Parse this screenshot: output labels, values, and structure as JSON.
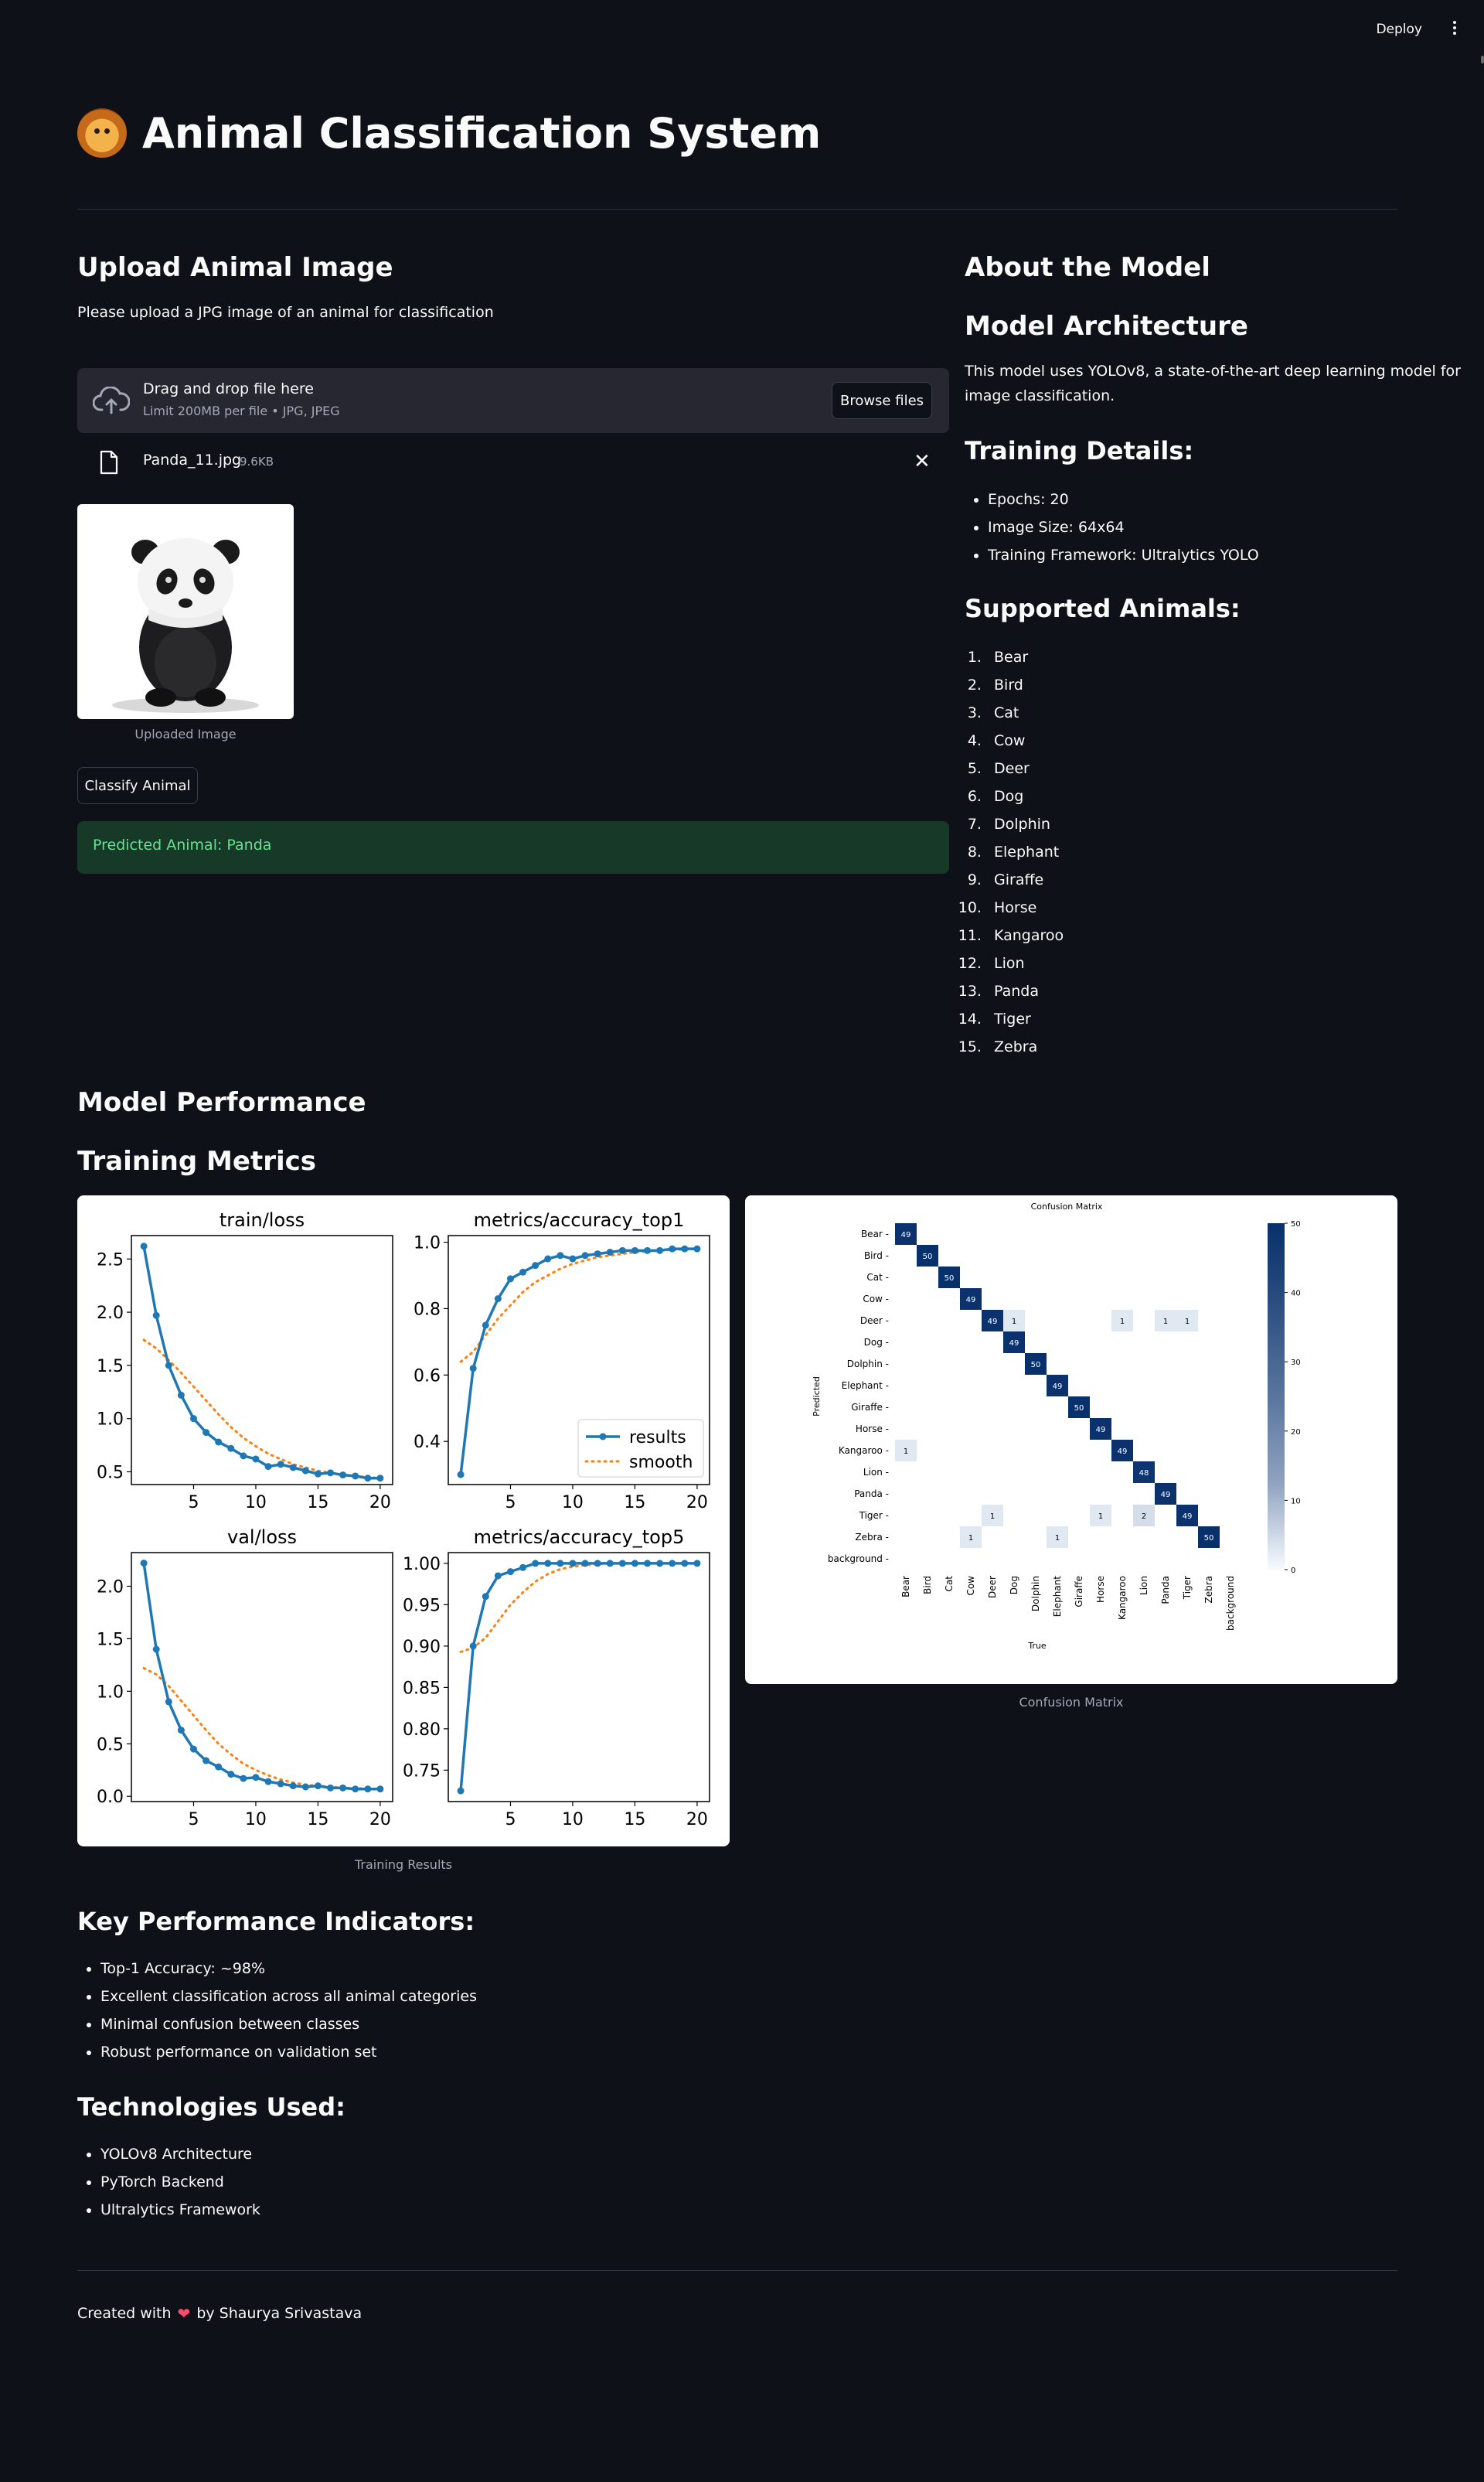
{
  "header": {
    "deploy_label": "Deploy"
  },
  "page": {
    "title": "Animal Classification System"
  },
  "upload": {
    "heading": "Upload Animal Image",
    "instruction": "Please upload a JPG image of an animal for classification",
    "drag_text": "Drag and drop file here",
    "limit_text": "Limit 200MB per file • JPG, JPEG",
    "browse_label": "Browse files",
    "file_name": "Panda_11.jpg",
    "file_size": "9.6KB",
    "image_caption": "Uploaded Image",
    "classify_label": "Classify Animal",
    "result_text": "Predicted Animal: Panda"
  },
  "about": {
    "heading": "About the Model",
    "arch_heading": "Model Architecture",
    "arch_text_1": "This model uses YOLOv8, a state-of-the-art deep learning model for",
    "arch_text_2": "image classification.",
    "training_heading": "Training Details:",
    "training_items": [
      "Epochs: 20",
      "Image Size: 64x64",
      "Training Framework: Ultralytics YOLO"
    ],
    "animals_heading": "Supported Animals:",
    "animals": [
      "Bear",
      "Bird",
      "Cat",
      "Cow",
      "Deer",
      "Dog",
      "Dolphin",
      "Elephant",
      "Giraffe",
      "Horse",
      "Kangaroo",
      "Lion",
      "Panda",
      "Tiger",
      "Zebra"
    ]
  },
  "performance": {
    "heading": "Model Performance",
    "metrics_heading": "Training Metrics",
    "training_caption": "Training Results",
    "cm_caption": "Confusion Matrix",
    "kpi_heading": "Key Performance Indicators:",
    "kpi_items": [
      "Top-1 Accuracy: ~98%",
      "Excellent classification across all animal categories",
      "Minimal confusion between classes",
      "Robust performance on validation set"
    ],
    "tech_heading": "Technologies Used:",
    "tech_items": [
      "YOLOv8 Architecture",
      "PyTorch Backend",
      "Ultralytics Framework"
    ]
  },
  "footer": {
    "prefix": "Created with",
    "suffix": "by Shaurya Srivastava"
  },
  "colors": {
    "background": "#0e1117",
    "result_bg": "#173928",
    "result_text": "#66e28f",
    "series_results": "#1f77b4",
    "series_smooth": "#ff7f0e",
    "cm_high": "#08306b"
  },
  "chart_data": [
    {
      "type": "line",
      "title": "train/loss",
      "x": [
        1,
        2,
        3,
        4,
        5,
        6,
        7,
        8,
        9,
        10,
        11,
        12,
        13,
        14,
        15,
        16,
        17,
        18,
        19,
        20
      ],
      "series": [
        {
          "name": "results",
          "values": [
            2.62,
            1.97,
            1.5,
            1.22,
            1.0,
            0.87,
            0.78,
            0.72,
            0.65,
            0.62,
            0.55,
            0.57,
            0.54,
            0.51,
            0.48,
            0.49,
            0.47,
            0.46,
            0.44,
            0.44
          ]
        },
        {
          "name": "smooth",
          "values": [
            1.74,
            1.66,
            1.55,
            1.43,
            1.3,
            1.17,
            1.04,
            0.92,
            0.82,
            0.74,
            0.67,
            0.62,
            0.57,
            0.54,
            0.51,
            0.49,
            0.47,
            0.46,
            0.45,
            0.44
          ]
        }
      ],
      "xticks": [
        5,
        10,
        15,
        20
      ],
      "yticks": [
        0.5,
        1.0,
        1.5,
        2.0,
        2.5
      ],
      "xlim": [
        0,
        21
      ],
      "ylim": [
        0.38,
        2.72
      ]
    },
    {
      "type": "line",
      "title": "metrics/accuracy_top1",
      "x": [
        1,
        2,
        3,
        4,
        5,
        6,
        7,
        8,
        9,
        10,
        11,
        12,
        13,
        14,
        15,
        16,
        17,
        18,
        19,
        20
      ],
      "series": [
        {
          "name": "results",
          "values": [
            0.3,
            0.62,
            0.75,
            0.83,
            0.89,
            0.91,
            0.93,
            0.95,
            0.96,
            0.95,
            0.96,
            0.965,
            0.97,
            0.975,
            0.975,
            0.975,
            0.975,
            0.98,
            0.98,
            0.98
          ]
        },
        {
          "name": "smooth",
          "values": [
            0.64,
            0.67,
            0.72,
            0.77,
            0.81,
            0.85,
            0.88,
            0.9,
            0.92,
            0.935,
            0.945,
            0.955,
            0.96,
            0.965,
            0.97,
            0.972,
            0.975,
            0.977,
            0.978,
            0.98
          ]
        }
      ],
      "xticks": [
        5,
        10,
        15,
        20
      ],
      "yticks": [
        0.4,
        0.6,
        0.8,
        1.0
      ],
      "xlim": [
        0,
        21
      ],
      "ylim": [
        0.27,
        1.02
      ],
      "legend": "lower-right"
    },
    {
      "type": "line",
      "title": "val/loss",
      "x": [
        1,
        2,
        3,
        4,
        5,
        6,
        7,
        8,
        9,
        10,
        11,
        12,
        13,
        14,
        15,
        16,
        17,
        18,
        19,
        20
      ],
      "series": [
        {
          "name": "results",
          "values": [
            2.22,
            1.4,
            0.9,
            0.63,
            0.45,
            0.34,
            0.28,
            0.21,
            0.17,
            0.18,
            0.14,
            0.12,
            0.1,
            0.09,
            0.1,
            0.08,
            0.08,
            0.07,
            0.07,
            0.07
          ]
        },
        {
          "name": "smooth",
          "values": [
            1.22,
            1.16,
            1.05,
            0.91,
            0.77,
            0.63,
            0.5,
            0.4,
            0.31,
            0.25,
            0.2,
            0.16,
            0.13,
            0.11,
            0.1,
            0.09,
            0.08,
            0.08,
            0.07,
            0.07
          ]
        }
      ],
      "xticks": [
        5,
        10,
        15,
        20
      ],
      "yticks": [
        0.0,
        0.5,
        1.0,
        1.5,
        2.0
      ],
      "xlim": [
        0,
        21
      ],
      "ylim": [
        -0.05,
        2.32
      ]
    },
    {
      "type": "line",
      "title": "metrics/accuracy_top5",
      "x": [
        1,
        2,
        3,
        4,
        5,
        6,
        7,
        8,
        9,
        10,
        11,
        12,
        13,
        14,
        15,
        16,
        17,
        18,
        19,
        20
      ],
      "series": [
        {
          "name": "results",
          "values": [
            0.725,
            0.9,
            0.96,
            0.985,
            0.99,
            0.995,
            1.0,
            1.0,
            1.0,
            1.0,
            1.0,
            1.0,
            1.0,
            1.0,
            1.0,
            1.0,
            1.0,
            1.0,
            1.0,
            1.0
          ]
        },
        {
          "name": "smooth",
          "values": [
            0.893,
            0.898,
            0.91,
            0.93,
            0.95,
            0.965,
            0.978,
            0.987,
            0.993,
            0.996,
            0.998,
            0.999,
            1.0,
            1.0,
            1.0,
            1.0,
            1.0,
            1.0,
            1.0,
            1.0
          ]
        }
      ],
      "xticks": [
        5,
        10,
        15,
        20
      ],
      "yticks": [
        0.75,
        0.8,
        0.85,
        0.9,
        0.95,
        1.0
      ],
      "xlim": [
        0,
        21
      ],
      "ylim": [
        0.712,
        1.013
      ]
    },
    {
      "type": "heatmap",
      "title": "Confusion Matrix",
      "xlabel": "True",
      "ylabel": "Predicted",
      "labels": [
        "Bear",
        "Bird",
        "Cat",
        "Cow",
        "Deer",
        "Dog",
        "Dolphin",
        "Elephant",
        "Giraffe",
        "Horse",
        "Kangaroo",
        "Lion",
        "Panda",
        "Tiger",
        "Zebra",
        "background"
      ],
      "cells": [
        [
          0,
          0,
          49
        ],
        [
          1,
          1,
          50
        ],
        [
          2,
          2,
          50
        ],
        [
          3,
          3,
          49
        ],
        [
          4,
          4,
          49
        ],
        [
          4,
          5,
          1
        ],
        [
          4,
          10,
          1
        ],
        [
          4,
          12,
          1
        ],
        [
          4,
          13,
          1
        ],
        [
          5,
          5,
          49
        ],
        [
          6,
          6,
          50
        ],
        [
          7,
          7,
          49
        ],
        [
          8,
          8,
          50
        ],
        [
          9,
          9,
          49
        ],
        [
          10,
          10,
          49
        ],
        [
          10,
          0,
          1
        ],
        [
          11,
          11,
          48
        ],
        [
          12,
          12,
          49
        ],
        [
          13,
          13,
          49
        ],
        [
          13,
          4,
          1
        ],
        [
          13,
          9,
          1
        ],
        [
          13,
          11,
          2
        ],
        [
          14,
          14,
          50
        ],
        [
          14,
          3,
          1
        ],
        [
          14,
          7,
          1
        ]
      ],
      "colorbar_ticks": [
        0,
        10,
        20,
        30,
        40,
        50
      ],
      "vmax": 50
    }
  ]
}
